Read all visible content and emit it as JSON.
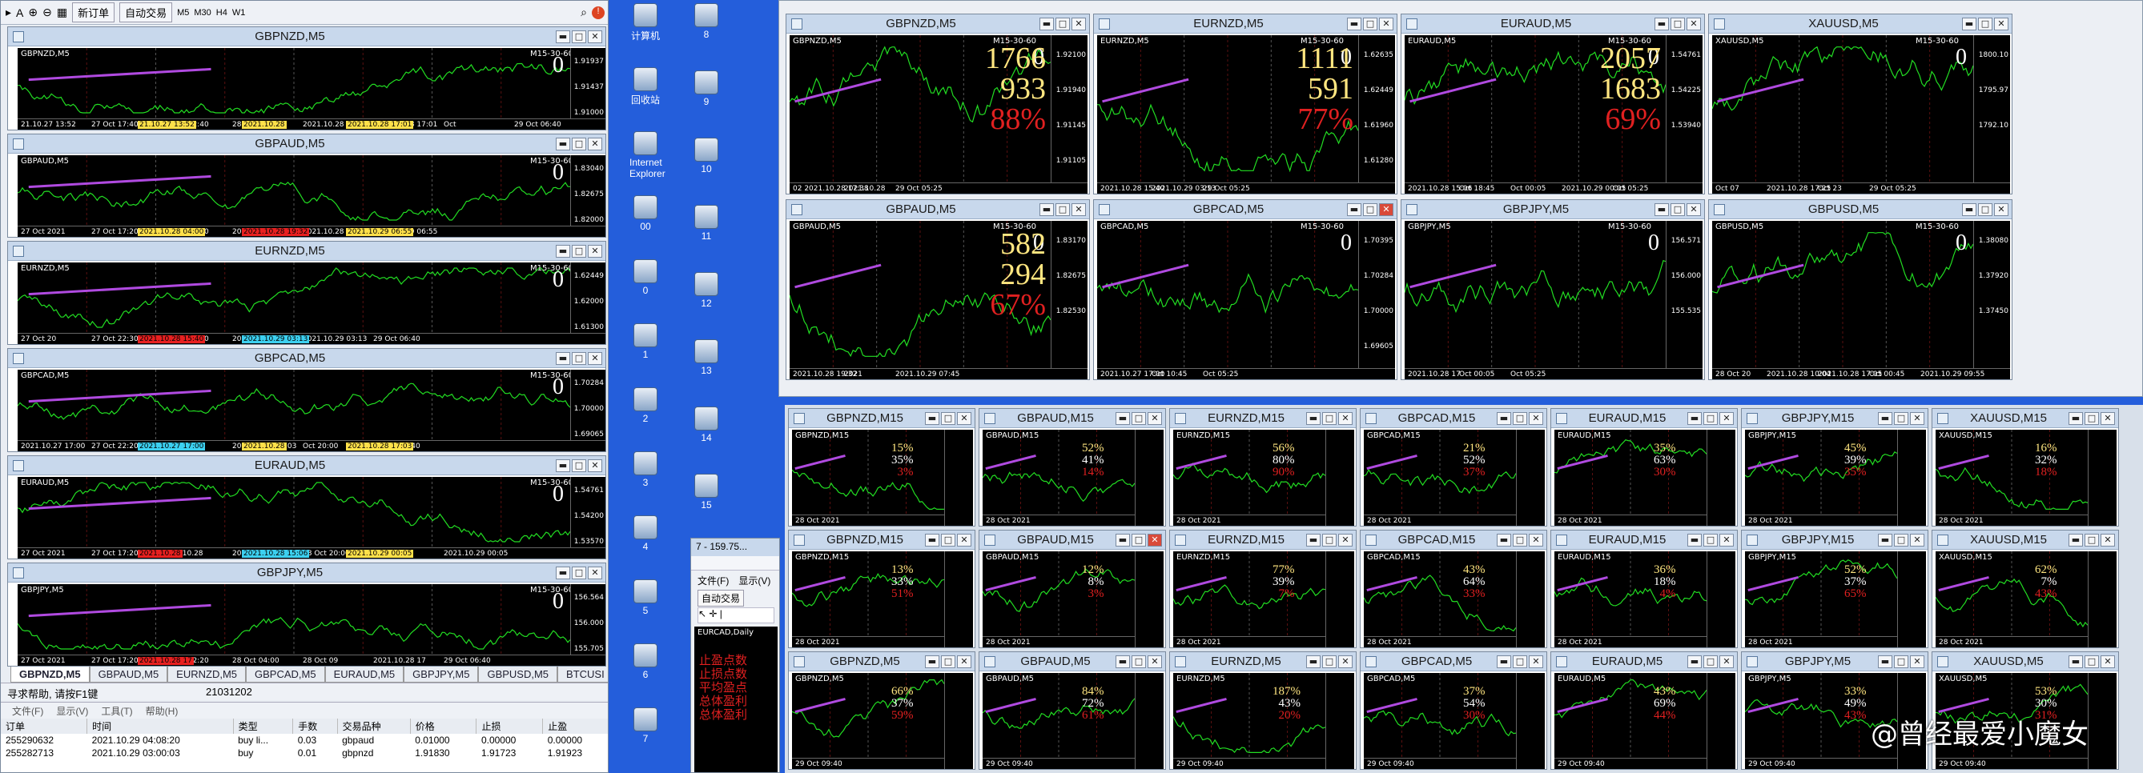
{
  "toolbar": {
    "buttons": [
      "新订单",
      "自动交易"
    ],
    "timeframes": [
      "M5",
      "M30",
      "H4",
      "W1"
    ]
  },
  "left_charts": [
    {
      "title": "GBPNZD,M5",
      "symbol": "GBPNZD,M5",
      "tf": "M15-30-60",
      "prices": [
        "1.91937",
        "1.91437",
        "1.91000"
      ],
      "times": [
        "21.10.27 13:52",
        "27 Oct 17:40",
        "27 Oct 22:40",
        "28 Oct 04:00",
        "2021.10.28",
        "2021.10.28 17:01",
        "Oct",
        "29 Oct 06:40"
      ],
      "labels": [
        {
          "t": "21.10.27 13:52",
          "c": "y"
        },
        {
          "t": "2021.10.28",
          "c": "y"
        },
        {
          "t": "2021.10.28 17:01",
          "c": "y"
        }
      ]
    },
    {
      "title": "GBPAUD,M5",
      "symbol": "GBPAUD,M5",
      "tf": "M15-30-60",
      "prices": [
        "1.83040",
        "1.82675",
        "1.82000"
      ],
      "times": [
        "27 Oct 2021",
        "27 Oct 17:20",
        "27 Oct 22:20",
        "2021.10.28 04:00",
        "2021.10.28 19:32",
        "2021.10.29 06:55"
      ],
      "labels": [
        {
          "t": "2021.10.28 04:00",
          "c": "y"
        },
        {
          "t": "2021.10.28 19:32",
          "c": "r"
        },
        {
          "t": "2021.10.29 06:55",
          "c": "y"
        }
      ]
    },
    {
      "title": "EURNZD,M5",
      "symbol": "EURNZD,M5",
      "tf": "M15-30-60",
      "prices": [
        "1.62449",
        "1.62000",
        "1.61300"
      ],
      "times": [
        "27 Oct 20",
        "27 Oct 22:30",
        "28 Oct 04:30",
        "2021.10.28 15:40",
        "2021.10.29 03:13",
        "29 Oct 06:40"
      ],
      "labels": [
        {
          "t": "2021.10.28 15:40",
          "c": "r"
        },
        {
          "t": "2021.10.29 03:13",
          "c": "c"
        }
      ]
    },
    {
      "title": "GBPCAD,M5",
      "symbol": "GBPCAD,M5",
      "tf": "M15-30-60",
      "prices": [
        "1.70284",
        "1.70000",
        "1.69065"
      ],
      "times": [
        "2021.10.27 17:00",
        "27 Oct 22:20",
        "28 Oct 04",
        "2021.10.28 17:03",
        "Oct 20:00",
        "29 Oct 06:40"
      ],
      "labels": [
        {
          "t": "2021.10.27 17:00",
          "c": "c"
        },
        {
          "t": "2021.10.28",
          "c": "y"
        },
        {
          "t": "2021.10.28 17:03",
          "c": "y"
        }
      ]
    },
    {
      "title": "EURAUD,M5",
      "symbol": "EURAUD,M5",
      "tf": "M15-30-60",
      "prices": [
        "1.54761",
        "1.54200",
        "1.53570"
      ],
      "times": [
        "27 Oct 2021",
        "27 Oct 17:20",
        "2021.10.28",
        "2021.10.28 15:06",
        "28 Oct 20:00",
        "Oct 01",
        "2021.10.29 00:05"
      ],
      "labels": [
        {
          "t": "2021.10.28",
          "c": "r"
        },
        {
          "t": "2021.10.28 15:06",
          "c": "c"
        },
        {
          "t": "2021.10.29 00:05",
          "c": "y"
        }
      ]
    },
    {
      "title": "GBPJPY,M5",
      "symbol": "GBPJPY,M5",
      "tf": "M15-30-60",
      "prices": [
        "156.564",
        "156.000",
        "155.705"
      ],
      "times": [
        "27 Oct 2021",
        "27 Oct 17:20",
        "27 Oct 22:20",
        "28 Oct 04:00",
        "28 Oct 09",
        "2021.10.28 17",
        "29 Oct 06:40"
      ],
      "labels": [
        {
          "t": "2021.10.28 17",
          "c": "r"
        }
      ]
    }
  ],
  "left_tabs": [
    "GBPNZD,M5",
    "GBPAUD,M5",
    "EURNZD,M5",
    "GBPCAD,M5",
    "EURAUD,M5",
    "GBPJPY,M5",
    "GBPUSD,M5",
    "BTCUSI"
  ],
  "status": {
    "help": "寻求帮助, 请按F1键",
    "account": "21031202"
  },
  "terminal": {
    "menu": [
      "文件(F)",
      "显示(V)",
      "工具(T)",
      "帮助(H)"
    ],
    "headers": [
      "订单",
      "时间",
      "类型",
      "手数",
      "交易品种",
      "价格",
      "止损",
      "止盈"
    ],
    "rows": [
      [
        "255290632",
        "2021.10.29 04:08:20",
        "buy li...",
        "0.03",
        "gbpaud",
        "0.01000",
        "0.00000",
        "0.00000"
      ],
      [
        "255282713",
        "2021.10.29 03:00:03",
        "buy",
        "0.01",
        "gbpnzd",
        "1.91830",
        "1.91723",
        "1.91923"
      ]
    ]
  },
  "desktop": {
    "left_icons": [
      "计算机",
      "回收站",
      "Internet Explorer",
      "00",
      "0",
      "1",
      "2",
      "3",
      "4",
      "5",
      "6",
      "7"
    ],
    "right_icons": [
      "8",
      "9",
      "10",
      "11",
      "12",
      "13",
      "14",
      "15"
    ]
  },
  "mini_window": {
    "title": "7 - 159.75...",
    "menu": [
      "文件(F)",
      "显示(V)"
    ],
    "auto": "自动交易",
    "chart": "EURCAD,Daily",
    "text": [
      "止盈点数",
      "止损点数",
      "平均盈点",
      "总体盈利",
      "总体盈利"
    ]
  },
  "big_charts": [
    {
      "title": "GBPNZD,M5",
      "tf": "M15-30-60",
      "stats": [
        "1766",
        "933",
        "88%"
      ],
      "prices": [
        "1.92100",
        "1.91940",
        "1.91145",
        "1.91105"
      ],
      "times": [
        "02 2021.10.28 17:38",
        "2021.10.28",
        "29 Oct 05:25"
      ]
    },
    {
      "title": "EURNZD,M5",
      "tf": "M15-30-60",
      "stats": [
        "1111",
        "591",
        "77%"
      ],
      "prices": [
        "1.62635",
        "1.62449",
        "1.61960",
        "1.61280"
      ],
      "times": [
        "2021.10.28 15:40",
        "2021.10.29 03:13",
        "29 Oct 05:25"
      ]
    },
    {
      "title": "EURAUD,M5",
      "tf": "M15-30-60",
      "stats": [
        "2057",
        "1683",
        "69%"
      ],
      "prices": [
        "1.54761",
        "1.54225",
        "1.53940"
      ],
      "times": [
        "2021.10.28 15:06",
        "Oct 18:45",
        "Oct 00:05",
        "2021.10.29 00:05",
        "Oct 05:25"
      ]
    },
    {
      "title": "XAUUSD,M5",
      "tf": "M15-30-60",
      "stats": [
        "",
        "",
        ""
      ],
      "prices": [
        "1800.10",
        "1795.97",
        "1792.10"
      ],
      "times": [
        "Oct 07",
        "2021.10.28 17:25",
        "Oct 23",
        "29 Oct 05:25"
      ]
    },
    {
      "title": "GBPAUD,M5",
      "tf": "M15-30-60",
      "stats": [
        "582",
        "294",
        "67%"
      ],
      "prices": [
        "1.83170",
        "1.82675",
        "1.82530"
      ],
      "times": [
        "2021.10.28 19:32",
        "2021",
        "2021.10.29 07:45"
      ]
    },
    {
      "title": "GBPCAD,M5",
      "tf": "M15-30-60",
      "stats": [
        "",
        "",
        ""
      ],
      "prices": [
        "1.70395",
        "1.70284",
        "1.70000",
        "1.69605"
      ],
      "times": [
        "2021.10.27 17:00",
        "Oct 10:45",
        "Oct 05:25"
      ]
    },
    {
      "title": "GBPJPY,M5",
      "tf": "M15-30-60",
      "stats": [
        "",
        "",
        ""
      ],
      "prices": [
        "156.571",
        "156.000",
        "155.535"
      ],
      "times": [
        "2021.10.28 17",
        "Oct 00:05",
        "Oct 05:25"
      ]
    },
    {
      "title": "GBPUSD,M5",
      "tf": "M15-30-60",
      "stats": [
        "",
        "",
        ""
      ],
      "prices": [
        "1.38080",
        "1.37920",
        "1.37450"
      ],
      "times": [
        "28 Oct 20",
        "2021.10.28 10:04",
        "2021.10.28 17:05",
        "Oct 00:45",
        "2021.10.29 09:55"
      ]
    }
  ],
  "mini_grid": {
    "cols": [
      "GBPNZD",
      "GBPAUD",
      "EURNZD",
      "GBPCAD",
      "EURAUD",
      "GBPJPY",
      "XAUUSD"
    ],
    "rows": [
      {
        "tf": "M15",
        "titles": [
          "GBPNZD,M15",
          "GBPAUD,M15",
          "EURNZD,M15",
          "GBPCAD,M15",
          "EURAUD,M15",
          "GBPJPY,M15",
          "XAUUSD,M15"
        ],
        "pcts": [
          [
            "15%",
            "35%",
            "3%"
          ],
          [
            "52%",
            "41%",
            "14%"
          ],
          [
            "56%",
            "80%",
            "90%"
          ],
          [
            "21%",
            "52%",
            "37%"
          ],
          [
            "35%",
            "63%",
            "30%"
          ],
          [
            "45%",
            "39%",
            "35%"
          ],
          [
            "16%",
            "32%",
            "18%"
          ]
        ],
        "time": "28 Oct 2021"
      },
      {
        "tf": "M15",
        "titles": [
          "GBPNZD,M15",
          "GBPAUD,M15",
          "EURNZD,M15",
          "GBPCAD,M15",
          "EURAUD,M15",
          "GBPJPY,M15",
          "XAUUSD,M15"
        ],
        "pcts": [
          [
            "13%",
            "33%",
            "51%"
          ],
          [
            "12%",
            "8%",
            "3%"
          ],
          [
            "77%",
            "39%",
            "7%"
          ],
          [
            "43%",
            "64%",
            "33%"
          ],
          [
            "36%",
            "18%",
            "4%"
          ],
          [
            "52%",
            "37%",
            "65%"
          ],
          [
            "62%",
            "7%",
            "43%"
          ]
        ],
        "time": "28 Oct 2021"
      },
      {
        "tf": "M5",
        "titles": [
          "GBPNZD,M5",
          "GBPAUD,M5",
          "EURNZD,M5",
          "GBPCAD,M5",
          "EURAUD,M5",
          "GBPJPY,M5",
          "XAUUSD,M5"
        ],
        "pcts": [
          [
            "66%",
            "37%",
            "59%"
          ],
          [
            "84%",
            "72%",
            "61%"
          ],
          [
            "187%",
            "43%",
            "20%"
          ],
          [
            "37%",
            "54%",
            "30%"
          ],
          [
            "43%",
            "69%",
            "44%"
          ],
          [
            "33%",
            "49%",
            "43%"
          ],
          [
            "53%",
            "30%",
            "31%"
          ]
        ],
        "time": "29 Oct 09:40"
      }
    ]
  },
  "watermark": "@曾经最爱小魔女",
  "colors": {
    "chart_bg": "#000000",
    "line": "#22dd22",
    "stat_yellow": "#ffe680",
    "stat_red": "#e02020",
    "desktop": "#245edb",
    "purple": "#b04ae0"
  }
}
